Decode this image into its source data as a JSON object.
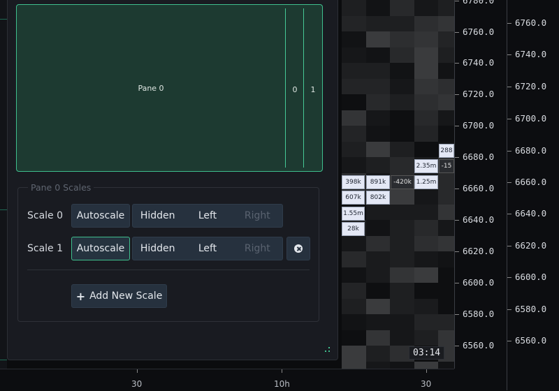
{
  "pane": {
    "name": "Pane 0",
    "columns": [
      "0",
      "1"
    ]
  },
  "scales_section": {
    "legend": "Pane 0 Scales",
    "rows": [
      {
        "label": "Scale 0",
        "autoscale": "Autoscale",
        "hidden": "Hidden",
        "left": "Left",
        "right": "Right",
        "autoscale_active": false
      },
      {
        "label": "Scale 1",
        "autoscale": "Autoscale",
        "hidden": "Hidden",
        "left": "Left",
        "right": "Right",
        "autoscale_active": true
      }
    ],
    "add_label": "Add New Scale",
    "add_icon": "plus-icon",
    "remove_icon": "close-circle-icon"
  },
  "price_axis_1": [
    "6780.0",
    "6760.0",
    "6740.0",
    "6720.0",
    "6700.0",
    "6680.0",
    "6660.0",
    "6640.0",
    "6620.0",
    "6600.0",
    "6580.0",
    "6560.0"
  ],
  "price_axis_2": [
    "6760.0",
    "6740.0",
    "6720.0",
    "6700.0",
    "6680.0",
    "6660.0",
    "6640.0",
    "6620.0",
    "6600.0",
    "6580.0",
    "6560.0"
  ],
  "time_axis": [
    "30",
    "10h",
    "30"
  ],
  "timer": "03:14",
  "heatmap_labels": [
    {
      "text": "288"
    },
    {
      "text": "2.35m"
    },
    {
      "text": "-15"
    },
    {
      "text": "398k"
    },
    {
      "text": "891k"
    },
    {
      "text": "-420k"
    },
    {
      "text": "1.25m"
    },
    {
      "text": "607k"
    },
    {
      "text": "802k"
    },
    {
      "text": "1.55m"
    },
    {
      "text": "28k"
    }
  ],
  "colors": {
    "accent": "#3fbf8e",
    "panel": "#191b21",
    "pane_fill": "#1d3a31"
  }
}
